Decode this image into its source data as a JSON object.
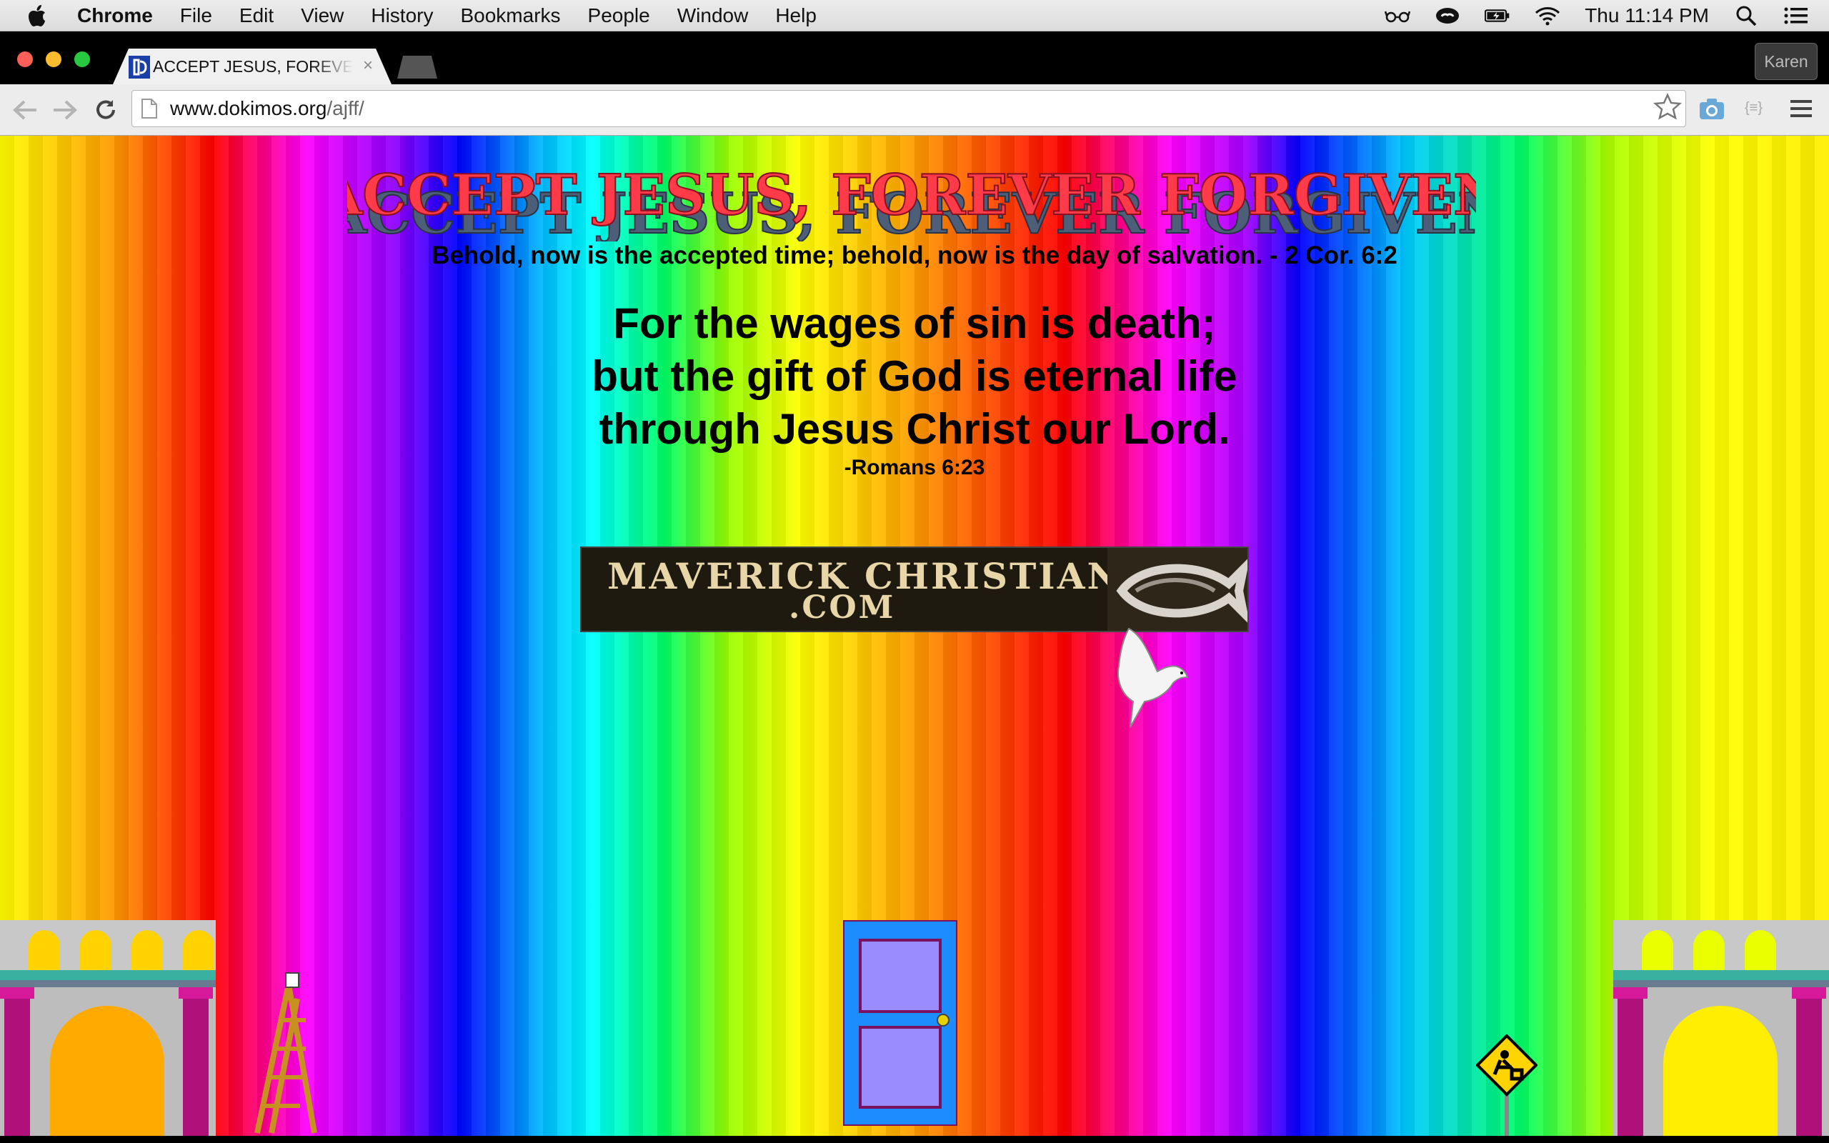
{
  "menubar": {
    "app_name": "Chrome",
    "items": [
      "File",
      "Edit",
      "View",
      "History",
      "Bookmarks",
      "People",
      "Window",
      "Help"
    ],
    "clock": "Thu 11:14 PM"
  },
  "browser": {
    "tab_title": "ACCEPT JESUS, FOREVER FORGIVEN",
    "tab_close": "×",
    "profile_name": "Karen",
    "url_host": "www.dokimos.org",
    "url_path": "/ajff/",
    "ext_label": "{≡}"
  },
  "page": {
    "banner_title": "ACCEPT JESUS, FOREVER FORGIVEN",
    "verse_small": "Behold, now is the accepted time; behold, now is the day of salvation. - 2 Cor. 6:2",
    "verse_lines": [
      "For the wages of sin is death;",
      "but the gift of God is eternal life",
      "through Jesus Christ our Lord."
    ],
    "verse_reference": "-Romans 6:23",
    "ad_line1": "MAVERICK CHRISTIANS",
    "ad_line2": ".COM"
  },
  "colors": {
    "banner_text": "#ff3b4a",
    "banner_shadow": "#5a6f86",
    "door_blue": "#1c8cff",
    "door_panel": "#9a8cff",
    "column_magenta": "#b0107a"
  }
}
